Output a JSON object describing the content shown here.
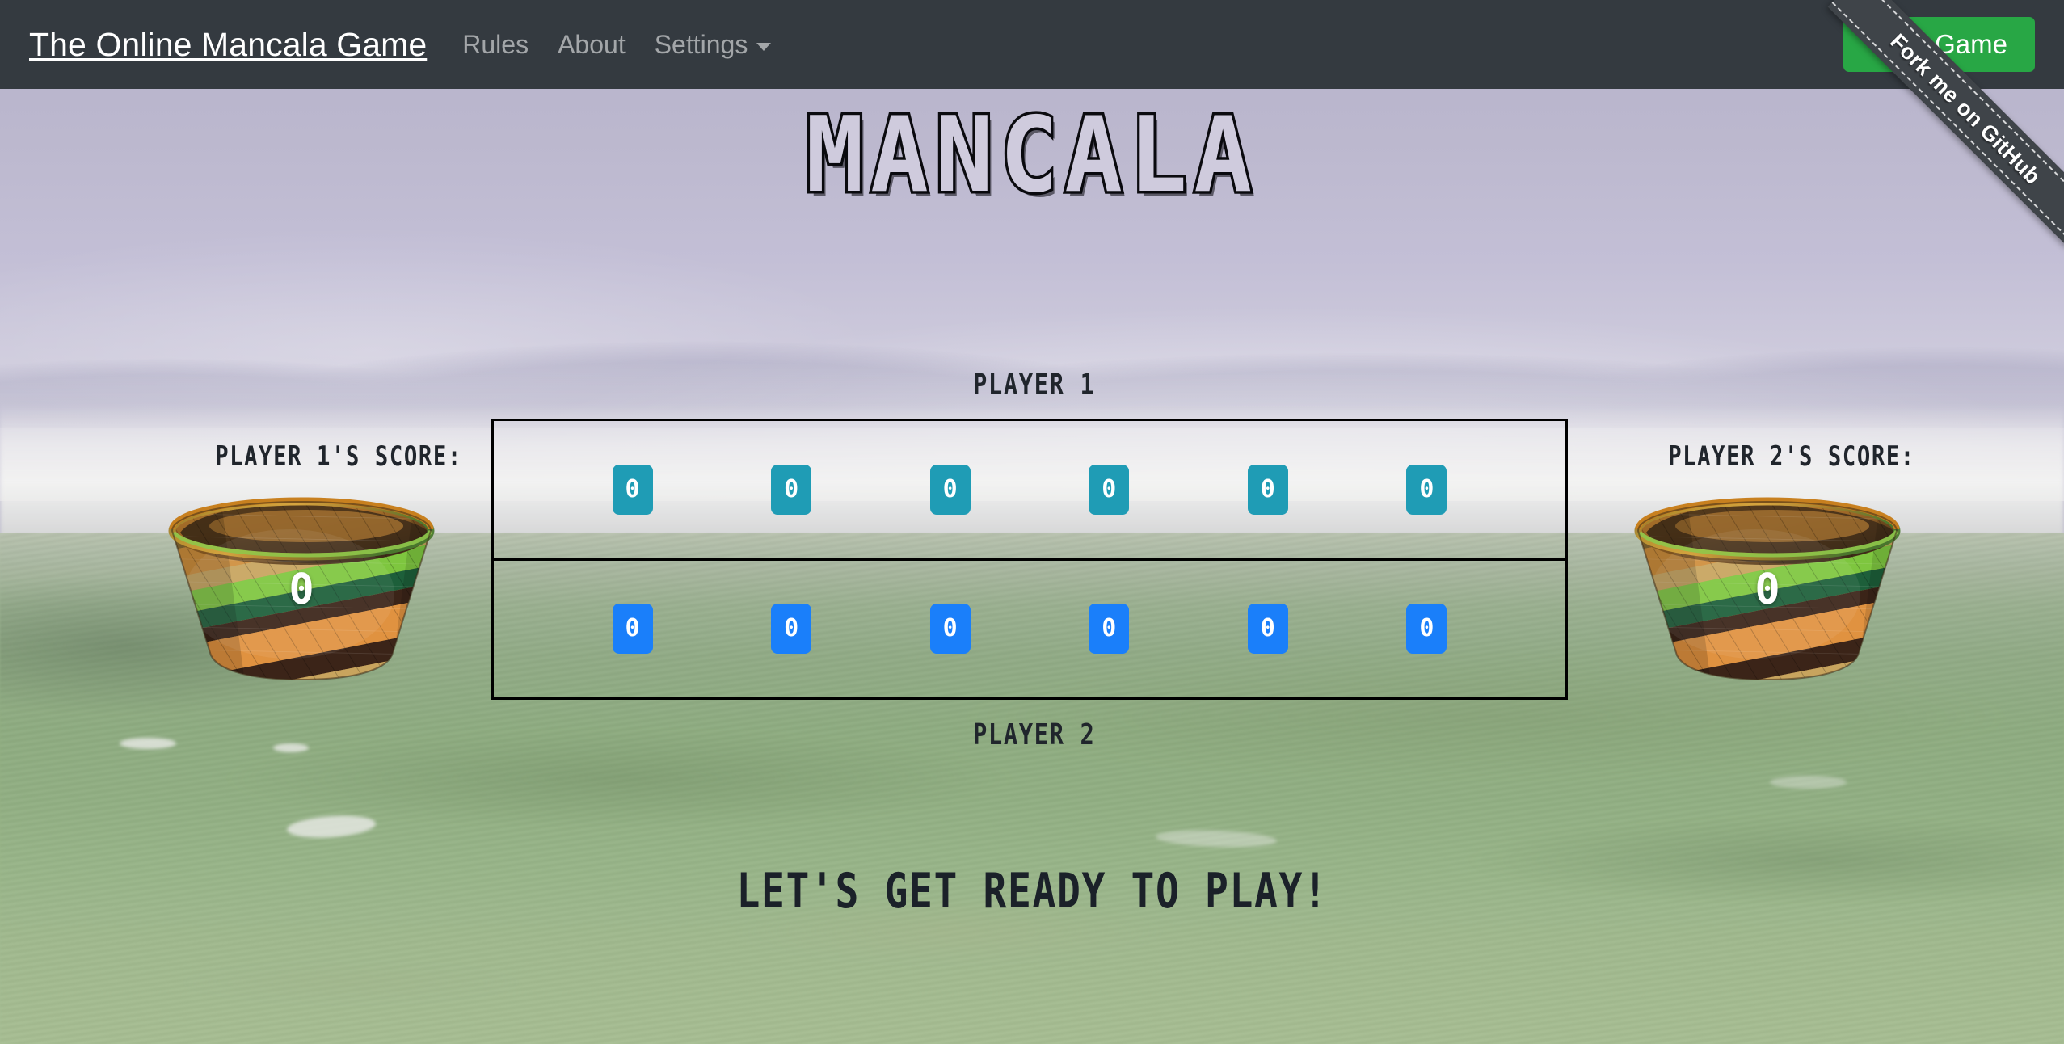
{
  "navbar": {
    "brand": "The Online Mancala Game",
    "links": [
      {
        "label": "Rules"
      },
      {
        "label": "About"
      },
      {
        "label": "Settings",
        "has_caret": true
      }
    ],
    "start_button": "Start Game",
    "bg_color": "#343a40",
    "start_button_color": "#28a745"
  },
  "ribbon": {
    "text": "Fork me on GitHub",
    "bg_color": "#3f4449"
  },
  "page": {
    "title": "MANCALA"
  },
  "board": {
    "player1_label": "PLAYER 1",
    "player2_label": "PLAYER 2",
    "player1_pit_color": "#1f9cb5",
    "player2_pit_color": "#1a7ffa",
    "player1_pits": [
      {
        "value": "0"
      },
      {
        "value": "0"
      },
      {
        "value": "0"
      },
      {
        "value": "0"
      },
      {
        "value": "0"
      },
      {
        "value": "0"
      }
    ],
    "player2_pits": [
      {
        "value": "0"
      },
      {
        "value": "0"
      },
      {
        "value": "0"
      },
      {
        "value": "0"
      },
      {
        "value": "0"
      },
      {
        "value": "0"
      }
    ]
  },
  "scores": {
    "player1_label": "PLAYER 1'S SCORE:",
    "player1_value": "0",
    "player2_label": "PLAYER 2'S SCORE:",
    "player2_value": "0"
  },
  "status": {
    "message": "LET'S GET READY TO PLAY!"
  }
}
